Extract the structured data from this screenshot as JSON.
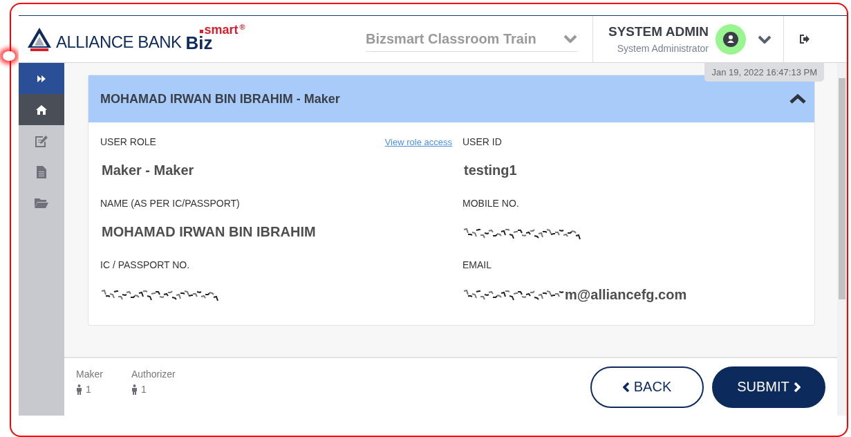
{
  "header": {
    "logo": {
      "bank": "ALLIANCE BANK",
      "biz": "Biz",
      "smart": "smart",
      "reg": "®"
    },
    "company_select": "Bizsmart Classroom Train",
    "user": {
      "name": "SYSTEM ADMIN",
      "role": "System Administrator"
    },
    "timestamp": "Jan 19, 2022 16:47:13 PM"
  },
  "sidebar": {
    "expanded": false,
    "items": [
      {
        "kind": "home",
        "selected": true
      },
      {
        "kind": "edit",
        "selected": false
      },
      {
        "kind": "document",
        "selected": false
      },
      {
        "kind": "folder",
        "selected": false
      }
    ]
  },
  "card": {
    "title": "MOHAMAD IRWAN BIN IBRAHIM - Maker",
    "expanded": true,
    "fields": [
      {
        "label": "USER ROLE",
        "kind": "text",
        "value": "Maker - Maker",
        "link": "View role access"
      },
      {
        "label": "USER ID",
        "kind": "text",
        "value": "testing1"
      },
      {
        "label": "NAME (AS PER IC/PASSPORT)",
        "kind": "text",
        "value": "MOHAMAD IRWAN BIN IBRAHIM"
      },
      {
        "label": "MOBILE NO.",
        "kind": "redacted"
      },
      {
        "label": "IC / PASSPORT NO.",
        "kind": "redacted"
      },
      {
        "label": "EMAIL",
        "kind": "partial",
        "value": "m@alliancefg.com"
      }
    ]
  },
  "footer": {
    "counts": [
      {
        "label": "Maker",
        "count": "1"
      },
      {
        "label": "Authorizer",
        "count": "1"
      }
    ],
    "buttons": [
      {
        "label": "BACK",
        "kind": "back"
      },
      {
        "label": "SUBMIT",
        "kind": "submit"
      }
    ]
  }
}
